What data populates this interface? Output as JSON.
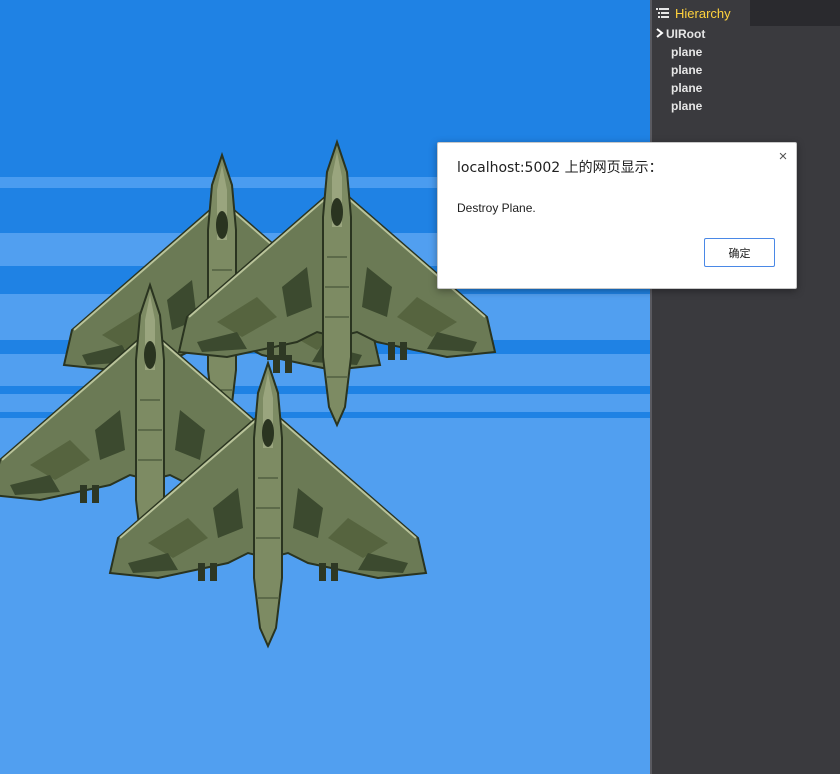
{
  "game": {
    "colors": {
      "sky_dark": "#1f82e4",
      "sky_light": "#519ff0",
      "stripe_light": "#4a9cf0",
      "stripe_dark": "#1f82e4",
      "plane_body": "#6b7a55",
      "plane_dark": "#3c4a2f",
      "plane_camo": "#56643f",
      "plane_highlight": "#b9c39a"
    },
    "planes": [
      {
        "icon": "jet-fighter-icon"
      },
      {
        "icon": "jet-fighter-icon"
      },
      {
        "icon": "jet-fighter-icon"
      },
      {
        "icon": "jet-fighter-icon"
      }
    ]
  },
  "hierarchy": {
    "tab_label": "Hierarchy",
    "tab_icon": "list-tree-icon",
    "tab_label_color": "#ffd23d",
    "root": {
      "label": "UIRoot",
      "icon": "chevron-right-icon"
    },
    "children": [
      {
        "label": "plane"
      },
      {
        "label": "plane"
      },
      {
        "label": "plane"
      },
      {
        "label": "plane"
      }
    ]
  },
  "alert": {
    "title": "localhost:5002 上的网页显示：",
    "message": "Destroy Plane.",
    "ok_label": "确定",
    "close_label": "×",
    "ok_border_color": "#4a88e6"
  }
}
